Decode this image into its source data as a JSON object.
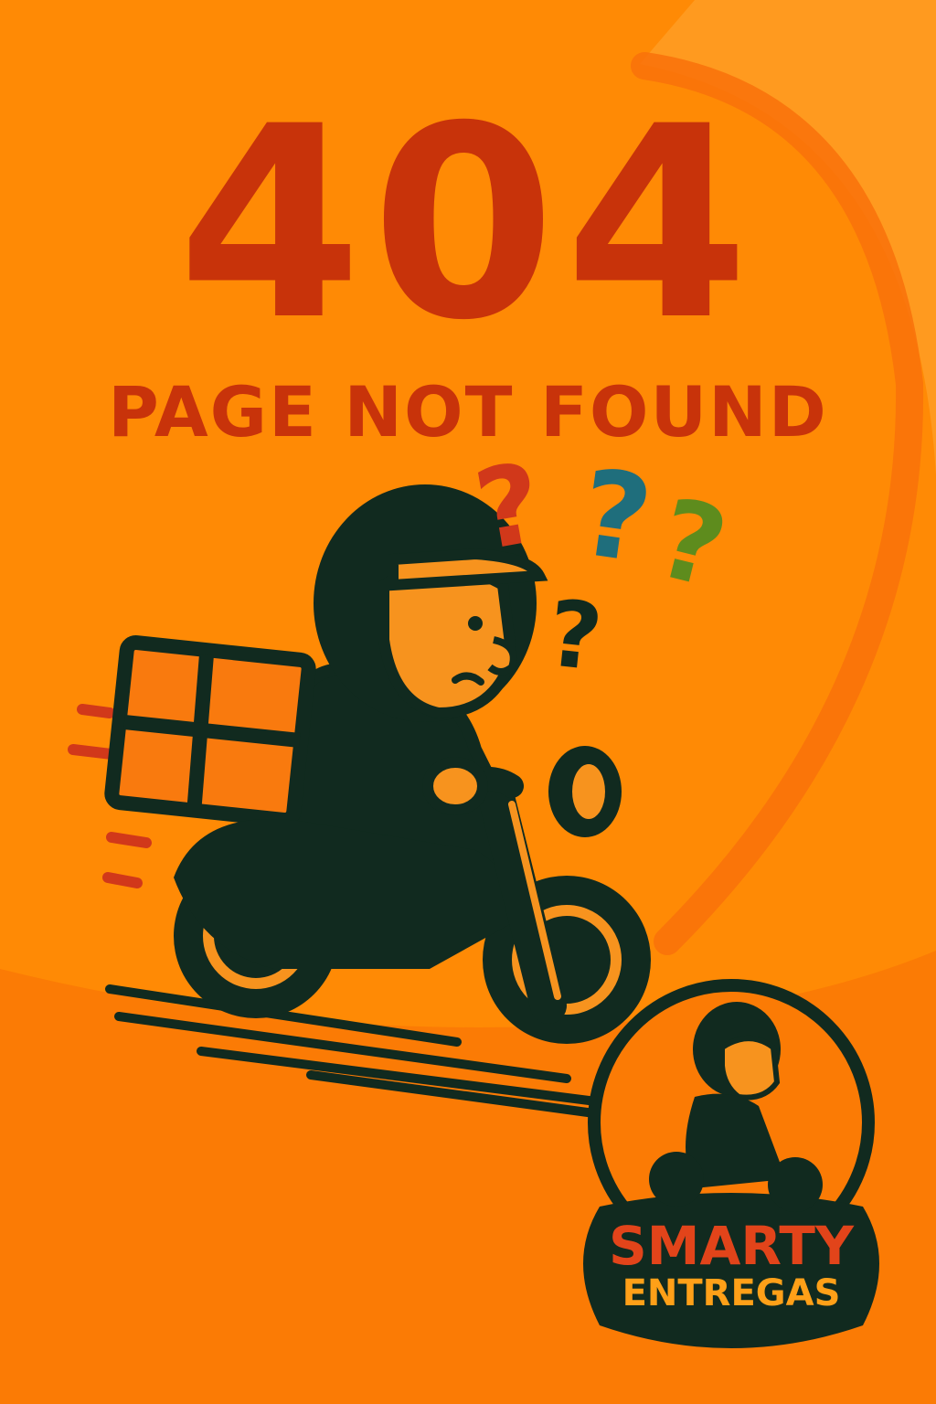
{
  "error": {
    "code": "404",
    "message": "PAGE NOT FOUND"
  },
  "question_marks": [
    {
      "glyph": "?",
      "color": "#D1381A"
    },
    {
      "glyph": "?",
      "color": "#1F6E7C"
    },
    {
      "glyph": "?",
      "color": "#5E8C1D"
    },
    {
      "glyph": "?",
      "color": "#112A1F"
    }
  ],
  "logo": {
    "brand": "SMARTY",
    "tagline": "ENTREGAS"
  },
  "colors": {
    "background": "#FF8A05",
    "headline": "#C8330A",
    "ink": "#112A1F",
    "cargo_box": "#F97A0E",
    "logo_brand": "#E2441A",
    "logo_tagline": "#FFA018"
  },
  "icons": [
    "delivery-rider-illustration",
    "cargo-box-icon",
    "scooter-icon",
    "speed-lines",
    "question-mark-icon",
    "mascot-logo"
  ]
}
